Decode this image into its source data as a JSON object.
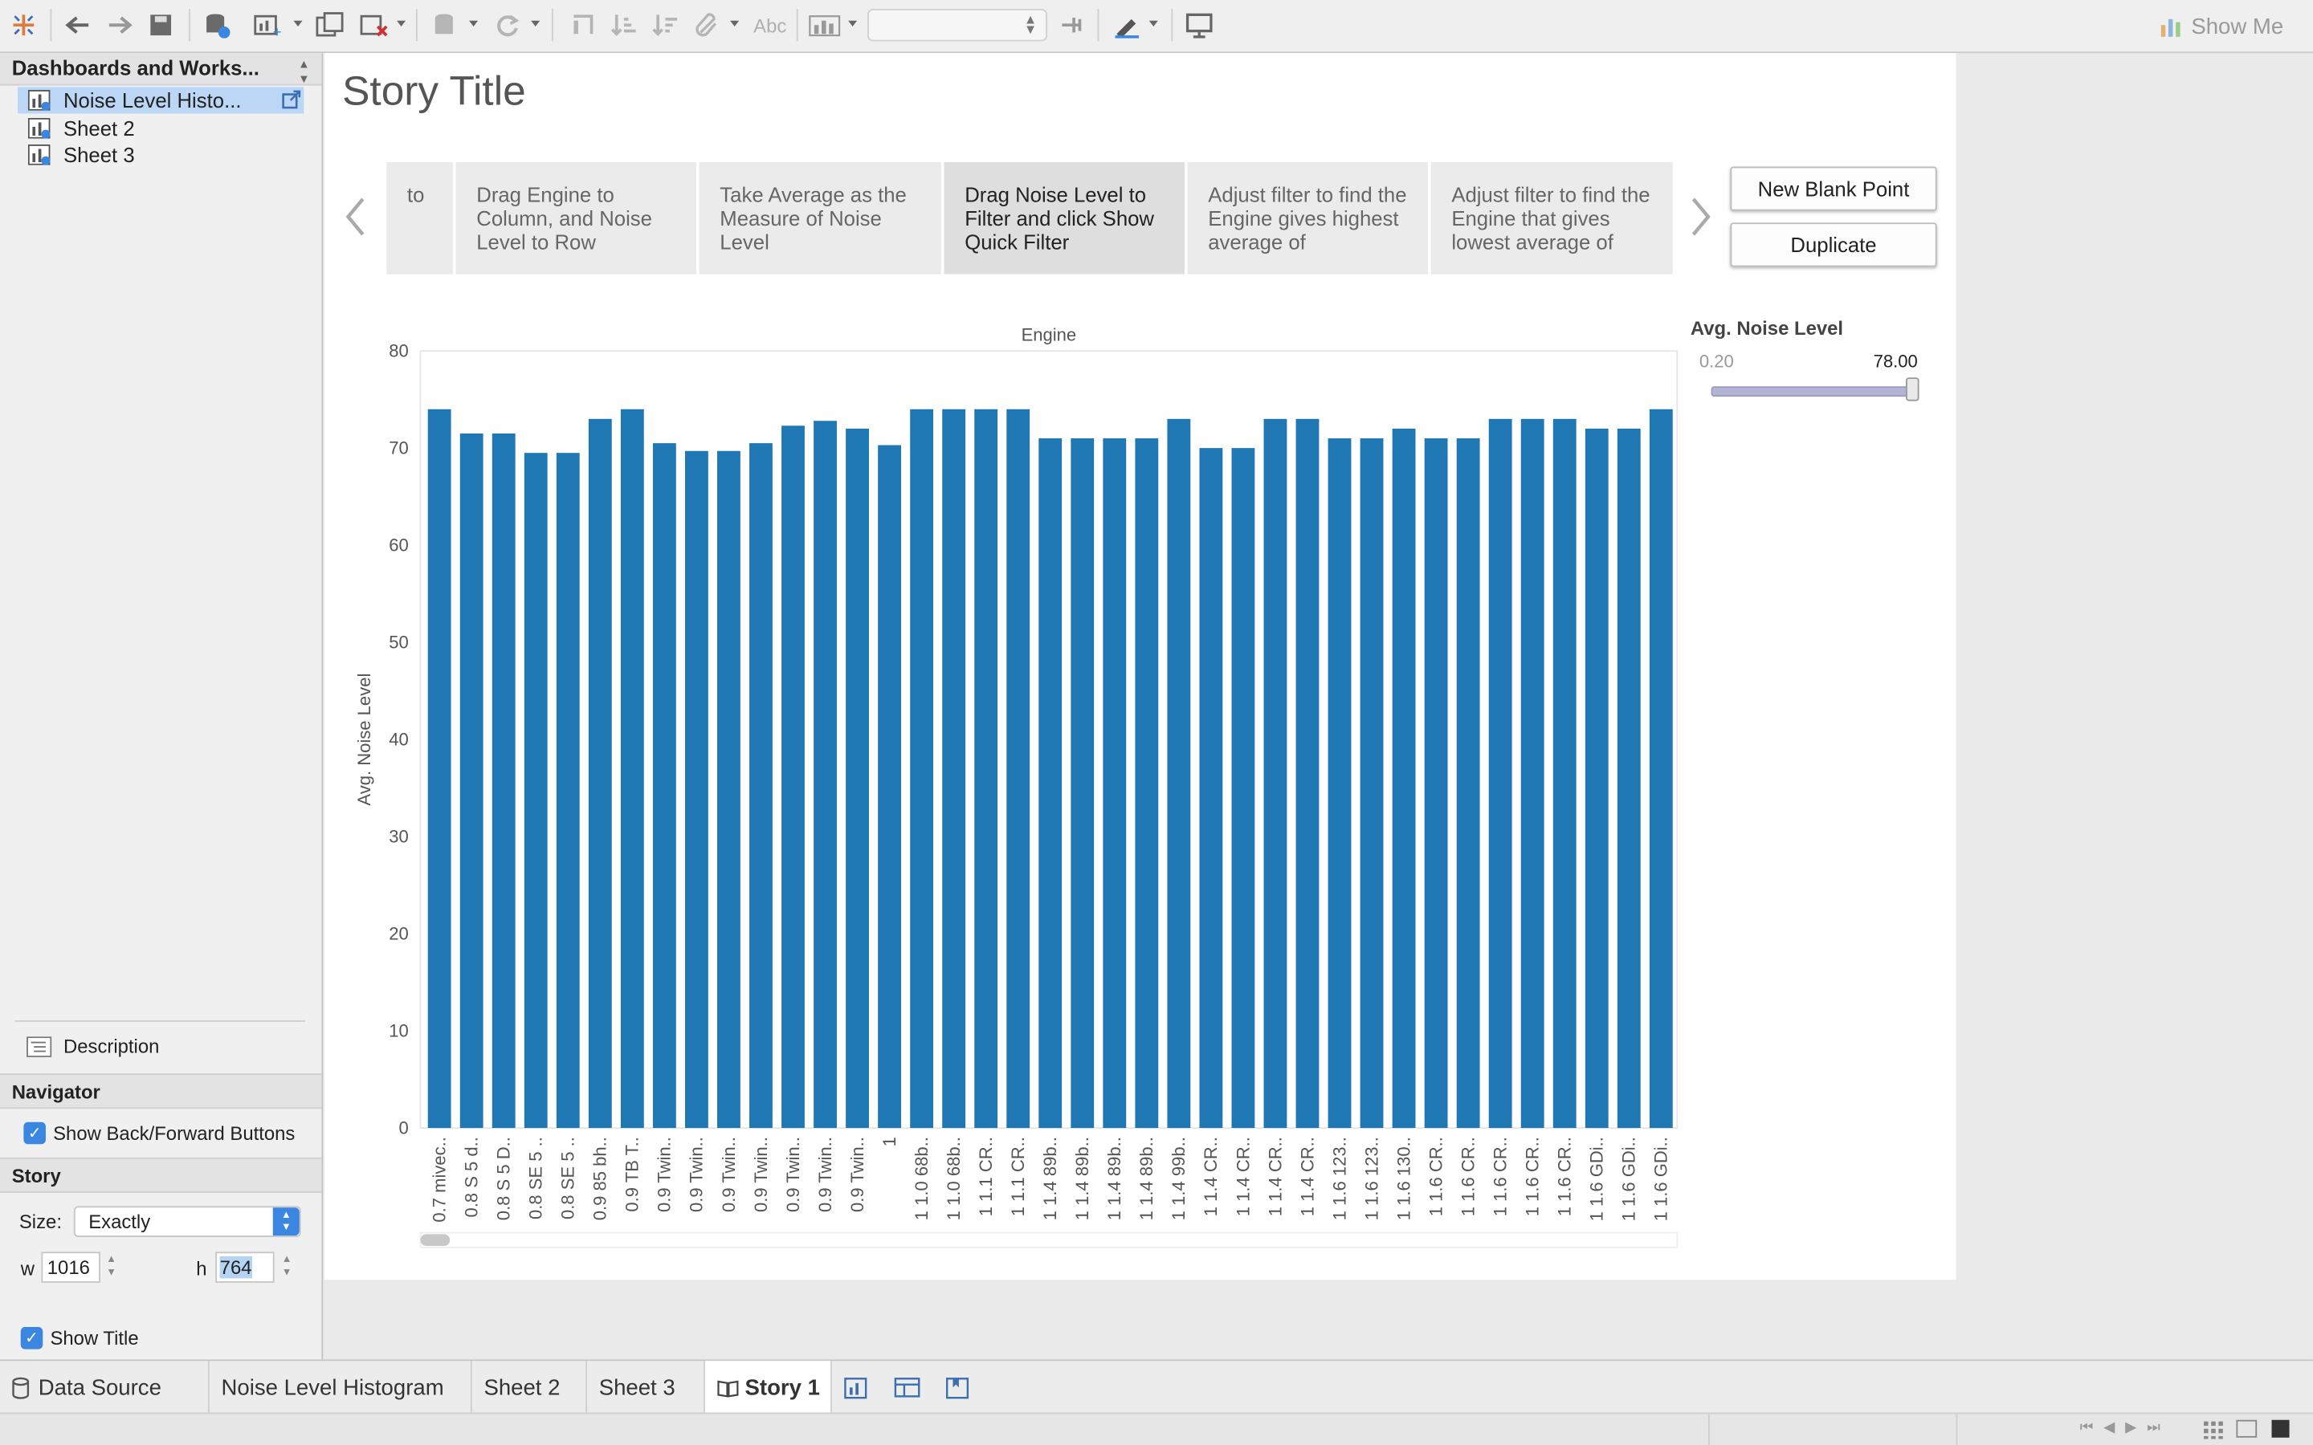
{
  "toolbar": {
    "show_me_label": "Show Me",
    "abc_label": "Abc",
    "combo_value": "",
    "icons": [
      "tableau-logo-icon",
      "undo-icon",
      "redo-icon",
      "save-icon",
      "new-data-source-icon",
      "new-worksheet-icon",
      "duplicate-sheet-icon",
      "clear-sheet-icon",
      "pause-updates-icon",
      "refresh-icon",
      "swap-icon",
      "sort-ascending-icon",
      "sort-descending-icon",
      "group-icon",
      "label-icon",
      "totals-icon",
      "fit-icon",
      "pin-icon",
      "highlight-icon",
      "presentation-icon"
    ]
  },
  "sidebar": {
    "header": "Dashboards and Works...",
    "items": [
      {
        "label": "Noise Level Histo...",
        "selected": true
      },
      {
        "label": "Sheet 2",
        "selected": false
      },
      {
        "label": "Sheet 3",
        "selected": false
      }
    ],
    "description_label": "Description",
    "navigator_header": "Navigator",
    "show_buttons_label": "Show Back/Forward Buttons",
    "story_header": "Story",
    "size_label": "Size:",
    "size_value": "Exactly",
    "w_label": "w",
    "w_value": "1016",
    "h_label": "h",
    "h_value": "764",
    "show_title_label": "Show Title"
  },
  "story": {
    "title": "Story Title",
    "points": [
      {
        "text": "to",
        "active": false
      },
      {
        "text": "Drag Engine to Column, and Noise Level to Row",
        "active": false
      },
      {
        "text": "Take Average as the Measure of Noise Level",
        "active": false
      },
      {
        "text": "Drag Noise Level to Filter and click Show Quick Filter",
        "active": true
      },
      {
        "text": "Adjust filter to find the Engine gives highest average of",
        "active": false
      },
      {
        "text": "Adjust filter to find the Engine that gives lowest average of",
        "active": false
      }
    ],
    "new_blank_label": "New Blank Point",
    "duplicate_label": "Duplicate"
  },
  "filter": {
    "title": "Avg. Noise Level",
    "min": "0.20",
    "max": "78.00",
    "slider_fraction": 1.0
  },
  "chart_data": {
    "type": "bar",
    "title": "Engine",
    "xlabel": "Engine",
    "ylabel": "Avg. Noise Level",
    "ylim": [
      0,
      80
    ],
    "yticks": [
      0,
      10,
      20,
      30,
      40,
      50,
      60,
      70,
      80
    ],
    "color": "#1f77b4",
    "categories": [
      "0.7 mivec..",
      "0.8 S 5 d..",
      "0.8 S 5 D..",
      "0.8 SE 5 ..",
      "0.8 SE 5 ..",
      "0.9 85 bh..",
      "0.9 TB T..",
      "0.9 Twin..",
      "0.9 Twin..",
      "0.9 Twin..",
      "0.9 Twin..",
      "0.9 Twin..",
      "0.9 Twin..",
      "0.9 Twin..",
      "1",
      "1 1.0 68b..",
      "1 1.0 68b..",
      "1 1.1 CR..",
      "1 1.1 CR..",
      "1 1.4 89b..",
      "1 1.4 89b..",
      "1 1.4 89b..",
      "1 1.4 89b..",
      "1 1.4 99b..",
      "1 1.4 CR..",
      "1 1.4 CR..",
      "1 1.4 CR..",
      "1 1.4 CR..",
      "1 1.6 123..",
      "1 1.6 123..",
      "1 1.6 130..",
      "1 1.6 CR..",
      "1 1.6 CR..",
      "1 1.6 CR..",
      "1 1.6 CR..",
      "1 1.6 CR..",
      "1 1.6 GDi..",
      "1 1.6 GDi..",
      "1 1.6 GDi.."
    ],
    "values": [
      74,
      71.5,
      71.5,
      69.5,
      69.5,
      73,
      74,
      70.5,
      69.7,
      69.7,
      70.5,
      72.3,
      72.8,
      72,
      70.3,
      74,
      74,
      74,
      74,
      71,
      71,
      71,
      71,
      73,
      70,
      70,
      73,
      73,
      71,
      71,
      72,
      71,
      71,
      73,
      73,
      73,
      72,
      72,
      74
    ]
  },
  "tabs": {
    "data_source": "Data Source",
    "noise": "Noise Level Histogram",
    "sheet2": "Sheet 2",
    "sheet3": "Sheet 3",
    "story1": "Story 1"
  }
}
